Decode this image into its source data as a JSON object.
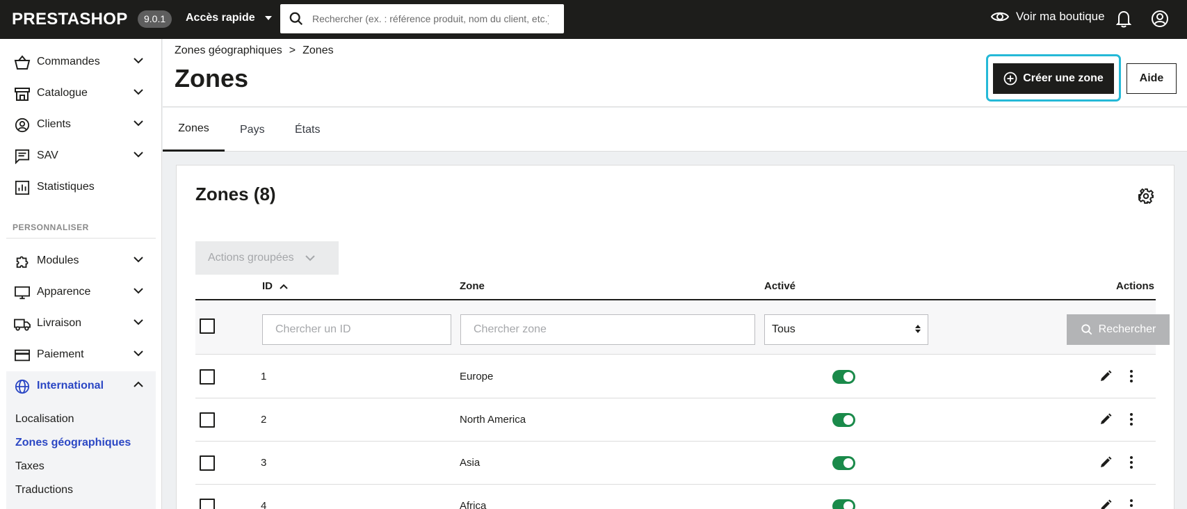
{
  "topbar": {
    "logo": "PRESTASHOP",
    "version": "9.0.1",
    "quick_access": "Accès rapide",
    "search_placeholder": "Rechercher (ex. : référence produit, nom du client, etc.)",
    "view_shop": "Voir ma boutique"
  },
  "sidebar": {
    "items": [
      {
        "label": "Commandes",
        "icon": "basket-icon"
      },
      {
        "label": "Catalogue",
        "icon": "store-icon"
      },
      {
        "label": "Clients",
        "icon": "user-circle-icon"
      },
      {
        "label": "SAV",
        "icon": "message-icon"
      },
      {
        "label": "Statistiques",
        "icon": "chart-icon"
      }
    ],
    "section_title": "PERSONNALISER",
    "custom_items": [
      {
        "label": "Modules",
        "icon": "puzzle-icon"
      },
      {
        "label": "Apparence",
        "icon": "monitor-icon"
      },
      {
        "label": "Livraison",
        "icon": "truck-icon"
      },
      {
        "label": "Paiement",
        "icon": "card-icon"
      },
      {
        "label": "International",
        "icon": "globe-icon"
      }
    ],
    "sub_items": [
      {
        "label": "Localisation"
      },
      {
        "label": "Zones géographiques"
      },
      {
        "label": "Taxes"
      },
      {
        "label": "Traductions"
      }
    ]
  },
  "header": {
    "breadcrumb": [
      "Zones géographiques",
      ">",
      "Zones"
    ],
    "title": "Zones",
    "create_button": "Créer une zone",
    "help_button": "Aide"
  },
  "tabs": [
    "Zones",
    "Pays",
    "États"
  ],
  "card": {
    "title": "Zones (8)",
    "bulk_actions": "Actions groupées",
    "columns": {
      "id": "ID",
      "zone": "Zone",
      "active": "Activé",
      "actions": "Actions"
    },
    "filters": {
      "id_placeholder": "Chercher un ID",
      "zone_placeholder": "Chercher zone",
      "active_value": "Tous",
      "search_button": "Rechercher"
    },
    "rows": [
      {
        "id": "1",
        "zone": "Europe"
      },
      {
        "id": "2",
        "zone": "North America"
      },
      {
        "id": "3",
        "zone": "Asia"
      },
      {
        "id": "4",
        "zone": "Africa"
      }
    ]
  },
  "colors": {
    "topbar": "#1d1d1b",
    "accent": "#2b47c4",
    "focus": "#25b9d7",
    "toggle_on": "#1a8a4a"
  }
}
